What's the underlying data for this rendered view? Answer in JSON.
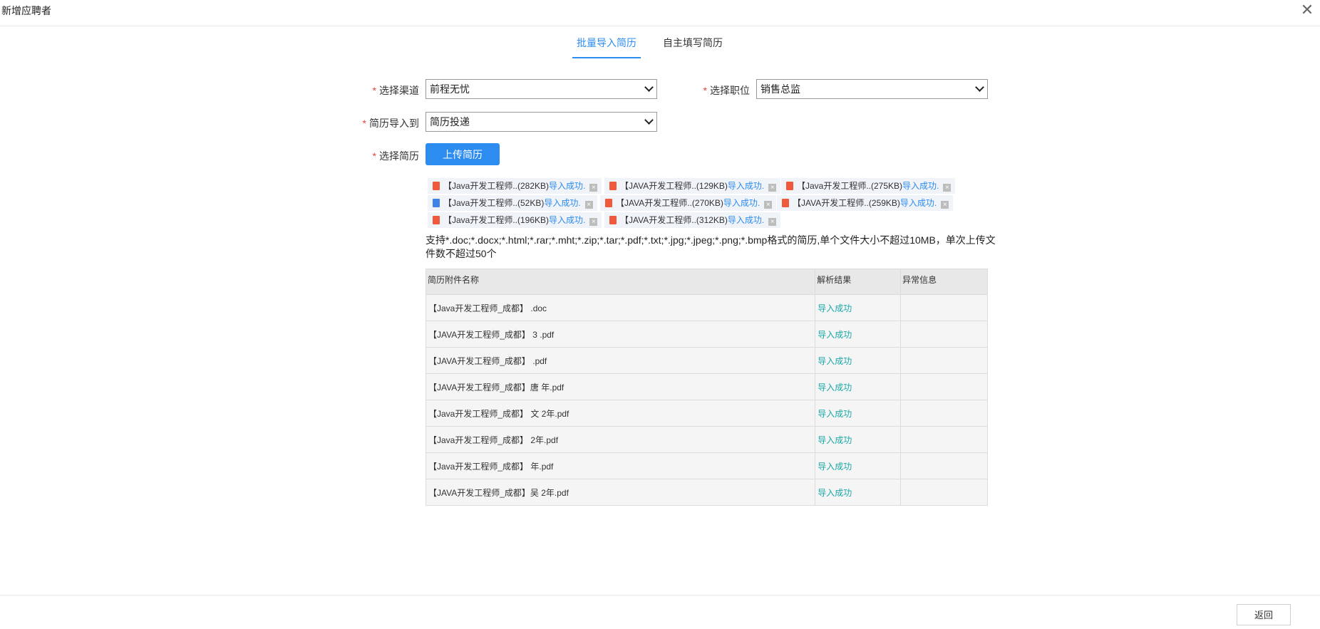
{
  "dialog": {
    "title": "新增应聘者"
  },
  "tabs": [
    {
      "label": "批量导入简历",
      "active": true
    },
    {
      "label": "自主填写简历",
      "active": false
    }
  ],
  "form": {
    "required_mark": "*",
    "channel": {
      "label": "选择渠道",
      "value": "前程无忧"
    },
    "position": {
      "label": "选择职位",
      "value": "销售总监"
    },
    "import_to": {
      "label": "简历导入到",
      "value": "简历投递"
    },
    "resume": {
      "label": "选择简历",
      "upload_label": "上传简历"
    }
  },
  "uploaded_files": [
    {
      "type": "pdf",
      "name": "【Java开发工程师..(282KB)",
      "status": "导入成功."
    },
    {
      "type": "pdf",
      "name": "【JAVA开发工程师..(129KB)",
      "status": "导入成功."
    },
    {
      "type": "pdf",
      "name": "【Java开发工程师..(275KB)",
      "status": "导入成功."
    },
    {
      "type": "doc",
      "name": "【Java开发工程师..(52KB)",
      "status": "导入成功."
    },
    {
      "type": "pdf",
      "name": "【JAVA开发工程师..(270KB)",
      "status": "导入成功."
    },
    {
      "type": "pdf",
      "name": "【JAVA开发工程师..(259KB)",
      "status": "导入成功."
    },
    {
      "type": "pdf",
      "name": "【Java开发工程师..(196KB)",
      "status": "导入成功."
    },
    {
      "type": "pdf",
      "name": "【JAVA开发工程师..(312KB)",
      "status": "导入成功."
    }
  ],
  "hint": "支持*.doc;*.docx;*.html;*.rar;*.mht;*.zip;*.tar;*.pdf;*.txt;*.jpg;*.jpeg;*.png;*.bmp格式的简历,单个文件大小不超过10MB，单次上传文件数不超过50个",
  "table": {
    "headers": [
      "简历附件名称",
      "解析结果",
      "异常信息"
    ],
    "rows": [
      {
        "name": "【Java开发工程师_成都】 .doc",
        "result": "导入成功",
        "error": ""
      },
      {
        "name": "【JAVA开发工程师_成都】 3 .pdf",
        "result": "导入成功",
        "error": ""
      },
      {
        "name": "【JAVA开发工程师_成都】 .pdf",
        "result": "导入成功",
        "error": ""
      },
      {
        "name": "【JAVA开发工程师_成都】唐 年.pdf",
        "result": "导入成功",
        "error": ""
      },
      {
        "name": "【Java开发工程师_成都】 文 2年.pdf",
        "result": "导入成功",
        "error": ""
      },
      {
        "name": "【Java开发工程师_成都】 2年.pdf",
        "result": "导入成功",
        "error": ""
      },
      {
        "name": "【Java开发工程师_成都】 年.pdf",
        "result": "导入成功",
        "error": ""
      },
      {
        "name": "【JAVA开发工程师_成都】吴 2年.pdf",
        "result": "导入成功",
        "error": ""
      }
    ]
  },
  "footer": {
    "back_label": "返回"
  }
}
